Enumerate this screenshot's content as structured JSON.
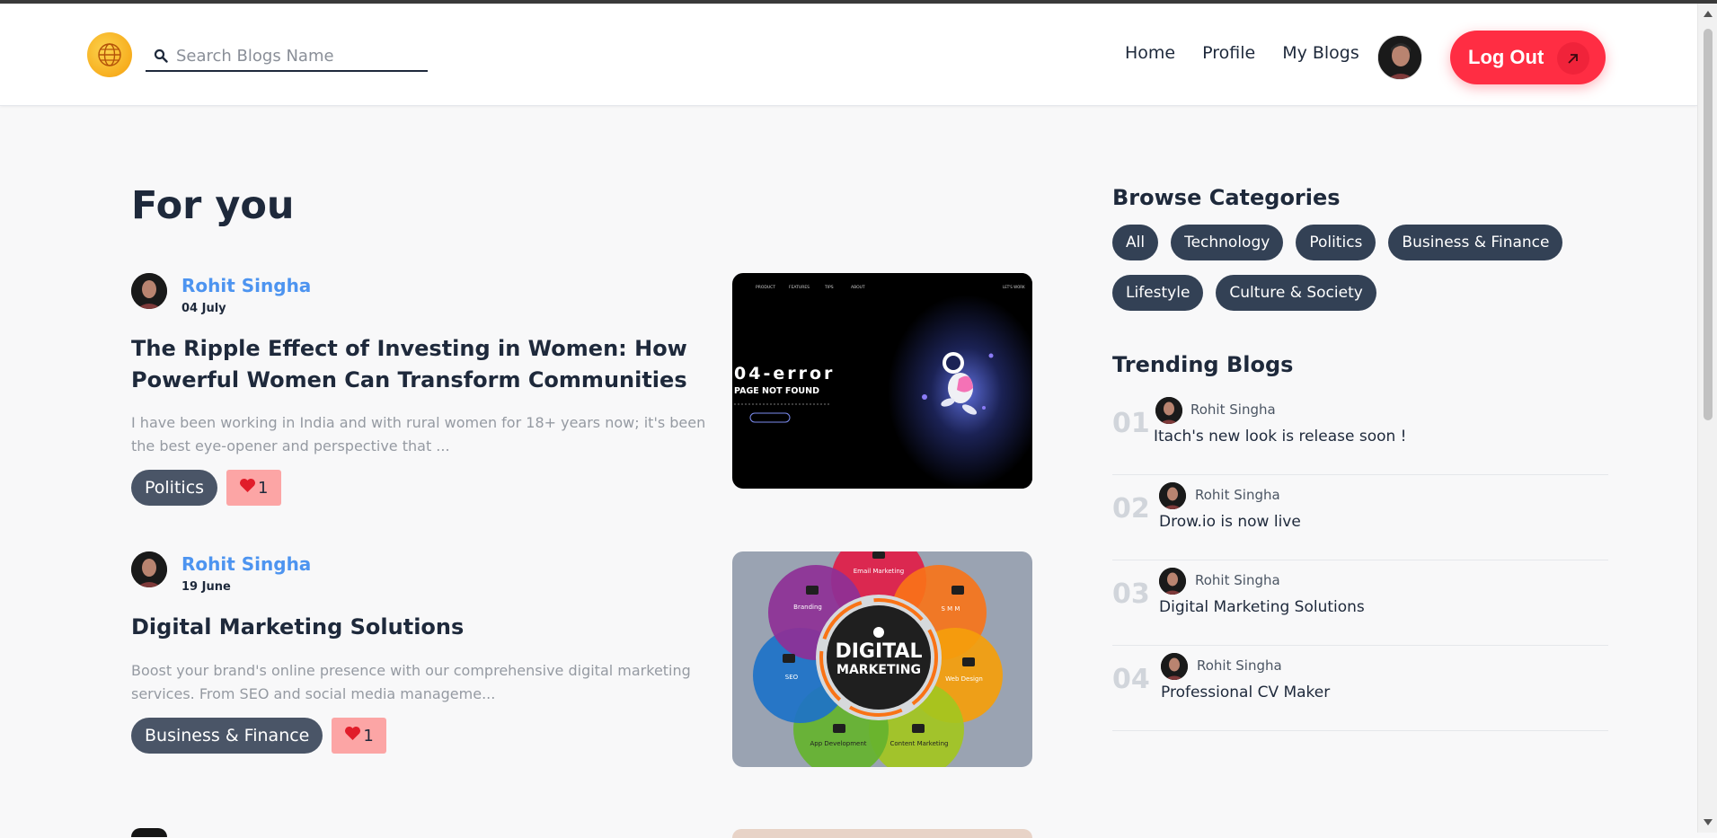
{
  "header": {
    "search_placeholder": "Search Blogs Name",
    "nav": [
      "Home",
      "Profile",
      "My Blogs"
    ],
    "logout_label": "Log Out",
    "logo_icon": "globe-icon",
    "search_icon": "search-icon"
  },
  "main": {
    "heading": "For you",
    "posts": [
      {
        "author": "Rohit Singha",
        "date": "04 July",
        "title": "The Ripple Effect of Investing in Women: How Powerful Women Can Transform Communities",
        "excerpt": "I have been working in India and with rural women for 18+ years now; it's been the best eye-opener and perspective that ...",
        "tag": "Politics",
        "likes": "1",
        "image": {
          "nav_text": [
            "PRODUCT",
            "FEATURES",
            "TIPS",
            "ABOUT",
            "LET'S WORK"
          ],
          "headline": "04-error",
          "subhead": "PAGE NOT FOUND"
        }
      },
      {
        "author": "Rohit Singha",
        "date": "19 June",
        "title": "Digital Marketing Solutions",
        "excerpt": "Boost your brand's online presence with our comprehensive digital marketing services. From SEO and social media manageme...",
        "tag": "Business & Finance",
        "likes": "1",
        "image": {
          "center_line1": "DIGITAL",
          "center_line2": "MARKETING",
          "segments": [
            "Email Marketing",
            "S M M",
            "Web Design",
            "Content Marketing",
            "App Development",
            "SEO",
            "Branding"
          ]
        }
      }
    ]
  },
  "sidebar": {
    "categories_heading": "Browse Categories",
    "categories": [
      "All",
      "Technology",
      "Politics",
      "Business & Finance",
      "Lifestyle",
      "Culture & Society"
    ],
    "trending_heading": "Trending Blogs",
    "trending": [
      {
        "num": "01",
        "author": "Rohit Singha",
        "title": "Itach's new look is release soon !"
      },
      {
        "num": "02",
        "author": "Rohit Singha",
        "title": "Drow.io is now live"
      },
      {
        "num": "03",
        "author": "Rohit Singha",
        "title": "Digital Marketing Solutions"
      },
      {
        "num": "04",
        "author": "Rohit Singha",
        "title": "Professional CV Maker"
      }
    ]
  },
  "colors": {
    "accent_red": "#ff2d43",
    "author_blue": "#4d94f0",
    "pill_dark": "#334155",
    "like_bg": "#fca5a5"
  }
}
